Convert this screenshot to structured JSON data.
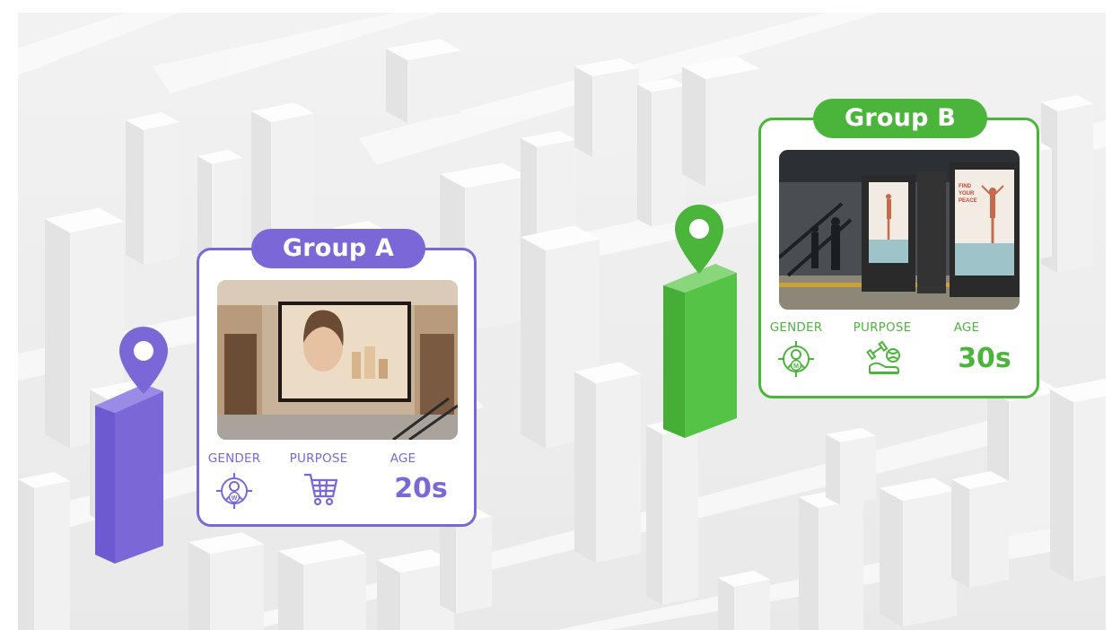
{
  "groups": [
    {
      "title": "Group A",
      "gender_label": "GENDER",
      "purpose_label": "PURPOSE",
      "age_label": "AGE",
      "age_value": "20s",
      "gender_icon": "female-target-icon",
      "purpose_icon": "shopping-cart-icon",
      "color": "#7b68d6"
    },
    {
      "title": "Group B",
      "gender_label": "GENDER",
      "purpose_label": "PURPOSE",
      "age_label": "AGE",
      "age_value": "30s",
      "gender_icon": "male-target-icon",
      "purpose_icon": "sports-fitness-icon",
      "color": "#4bb53b"
    }
  ],
  "billboard_a": {
    "lettering": [
      "FIND",
      "YOUR",
      "PEACE"
    ]
  },
  "billboard_b": {
    "lettering": [
      "FIND",
      "YOUR",
      "PEACE"
    ]
  }
}
